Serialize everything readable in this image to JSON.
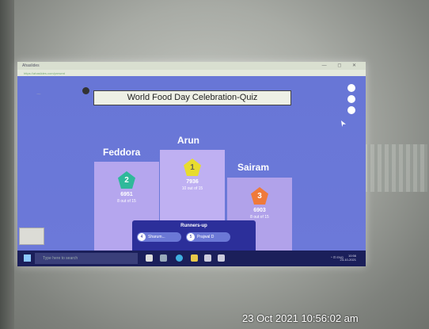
{
  "window": {
    "title": "Ahaslides",
    "controls": "— ◻ ✕",
    "address": "https://ahaslides.com/present"
  },
  "quiz": {
    "title": "World Food Day Celebration-Quiz"
  },
  "leaderboard": [
    {
      "rank": "1",
      "name": "Arun",
      "score": "7936",
      "detail": "10 out of 15"
    },
    {
      "rank": "2",
      "name": "Feddora",
      "score": "6951",
      "detail": "8 out of 15"
    },
    {
      "rank": "3",
      "name": "Sairam",
      "score": "6903",
      "detail": "8 out of 15"
    }
  ],
  "runners_up": {
    "title": "Runners-up",
    "items": [
      {
        "rank": "4",
        "name": "Sharum..."
      },
      {
        "rank": "5",
        "name": "Prajwal D"
      }
    ]
  },
  "taskbar": {
    "search_placeholder": "Type here to search",
    "tray": "^ ⊡ ENG",
    "time": "10:56",
    "date": "23-10-2021"
  },
  "photo": {
    "timestamp": "23 Oct 2021 10:56:02 am"
  },
  "colors": {
    "screen_bg": "#6a78d8",
    "podium": "#b5a6ee",
    "gold": "#e8dc2e",
    "silver_teal": "#2fb99a",
    "bronze": "#ef7a3a",
    "runners_bg": "#2c2f9a",
    "taskbar": "#1b1f5a"
  }
}
